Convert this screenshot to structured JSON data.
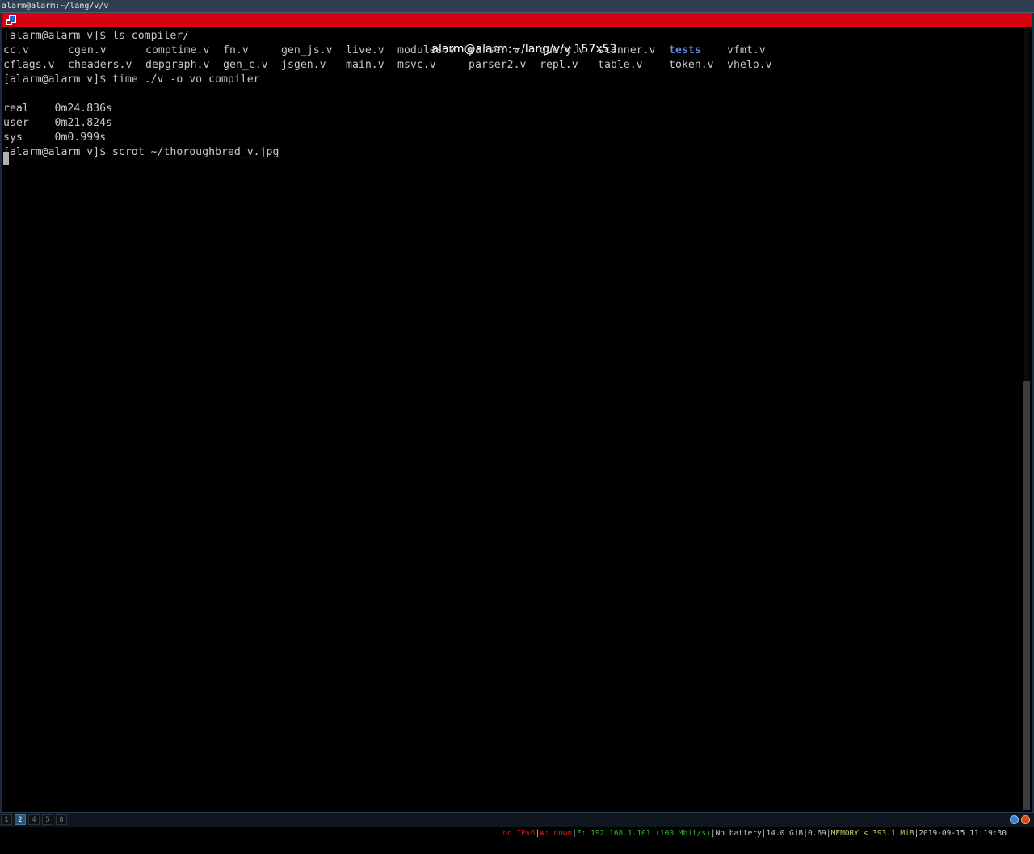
{
  "wm_title": "alarm@alarm:~/lang/v/v",
  "window": {
    "title": "alarm@alarm:~/lang/v/v 157x53"
  },
  "terminal": {
    "lines": [
      {
        "text": "[alarm@alarm v]$ ls compiler/"
      },
      {
        "cells": [
          {
            "text": "cc.v",
            "col": 0
          },
          {
            "text": "cgen.v",
            "col": 10
          },
          {
            "text": "comptime.v",
            "col": 22
          },
          {
            "text": "fn.v",
            "col": 34
          },
          {
            "text": "gen_js.v",
            "col": 43
          },
          {
            "text": "live.v",
            "col": 53
          },
          {
            "text": "modules.v",
            "col": 61
          },
          {
            "text": "parser.v",
            "col": 72
          },
          {
            "text": "query.v",
            "col": 83
          },
          {
            "text": "scanner.v",
            "col": 92
          },
          {
            "text": "tests",
            "col": 103,
            "type": "dir"
          },
          {
            "text": "vfmt.v",
            "col": 112
          }
        ]
      },
      {
        "cells": [
          {
            "text": "cflags.v",
            "col": 0
          },
          {
            "text": "cheaders.v",
            "col": 10
          },
          {
            "text": "depgraph.v",
            "col": 22
          },
          {
            "text": "gen_c.v",
            "col": 34
          },
          {
            "text": "jsgen.v",
            "col": 43
          },
          {
            "text": "main.v",
            "col": 53
          },
          {
            "text": "msvc.v",
            "col": 61
          },
          {
            "text": "parser2.v",
            "col": 72
          },
          {
            "text": "repl.v",
            "col": 83
          },
          {
            "text": "table.v",
            "col": 92
          },
          {
            "text": "token.v",
            "col": 103
          },
          {
            "text": "vhelp.v",
            "col": 112
          }
        ]
      },
      {
        "text": "[alarm@alarm v]$ time ./v -o vo compiler"
      },
      {
        "text": ""
      },
      {
        "text": "real\t0m24.836s"
      },
      {
        "text": "user\t0m21.824s"
      },
      {
        "text": "sys\t0m0.999s"
      },
      {
        "text": "[alarm@alarm v]$ scrot ~/thoroughbred_v.jpg"
      }
    ]
  },
  "scrollbar": {
    "position_fraction": 0.45,
    "visible_fraction": 0.55
  },
  "workspaces": [
    {
      "label": "1",
      "active": false
    },
    {
      "label": "2",
      "active": true
    },
    {
      "label": "4",
      "active": false
    },
    {
      "label": "5",
      "active": false
    },
    {
      "label": "8",
      "active": false
    }
  ],
  "status": {
    "ipv6": "no IPv6",
    "wireless": "W: down",
    "ethernet": "E: 192.168.1.101 (100 Mbit/s)",
    "battery": "No battery",
    "disk": "14.0 GiB",
    "load": "0.69",
    "memory": "MEMORY < 393.1 MiB",
    "datetime": "2019-09-15 11:19:30"
  },
  "colors": {
    "titlebar": "#d7000f",
    "dir": "#5f8fd8",
    "bad": "#cc1f1f",
    "good": "#2fb52f",
    "warn": "#c8c86e"
  }
}
